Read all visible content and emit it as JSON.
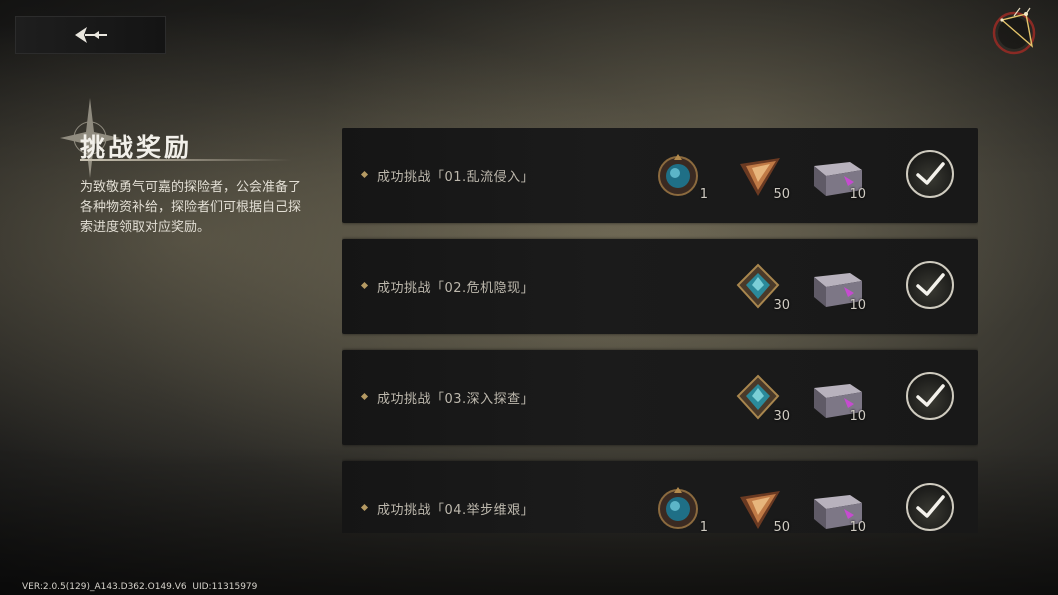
{
  "header": {
    "back_icon": "back-arrow-icon",
    "compass_icon": "compass-map-icon"
  },
  "panel": {
    "title": "挑战奖励",
    "description": "为致敬勇气可嘉的探险者，公会准备了各种物资补给，探险者们可根据自己探索进度领取对应奖励。"
  },
  "challenges": [
    {
      "label": "成功挑战「01.乱流侵入」",
      "rewards": [
        {
          "icon": "blue-orb-emblem-icon",
          "count": "1"
        },
        {
          "icon": "copper-crystal-shard-icon",
          "count": "50"
        },
        {
          "icon": "supply-crate-icon",
          "count": "10"
        }
      ],
      "claimed": true
    },
    {
      "label": "成功挑战「02.危机隐现」",
      "rewards": [
        {
          "icon": "cyan-gem-emblem-icon",
          "count": "30"
        },
        {
          "icon": "supply-crate-icon",
          "count": "10"
        }
      ],
      "claimed": true
    },
    {
      "label": "成功挑战「03.深入探查」",
      "rewards": [
        {
          "icon": "cyan-gem-emblem-icon",
          "count": "30"
        },
        {
          "icon": "supply-crate-icon",
          "count": "10"
        }
      ],
      "claimed": true
    },
    {
      "label": "成功挑战「04.举步维艰」",
      "rewards": [
        {
          "icon": "blue-orb-emblem-icon",
          "count": "1"
        },
        {
          "icon": "copper-crystal-shard-icon",
          "count": "50"
        },
        {
          "icon": "supply-crate-icon",
          "count": "10"
        }
      ],
      "claimed": true
    }
  ],
  "footer": {
    "version": "VER:2.0.5(129)_A143.D362.O149.V6",
    "uid": "UID:11315979"
  },
  "colors": {
    "row_bg": "#181818",
    "accent_gold": "#b59a63",
    "check_ring": "#cfcbbf"
  }
}
